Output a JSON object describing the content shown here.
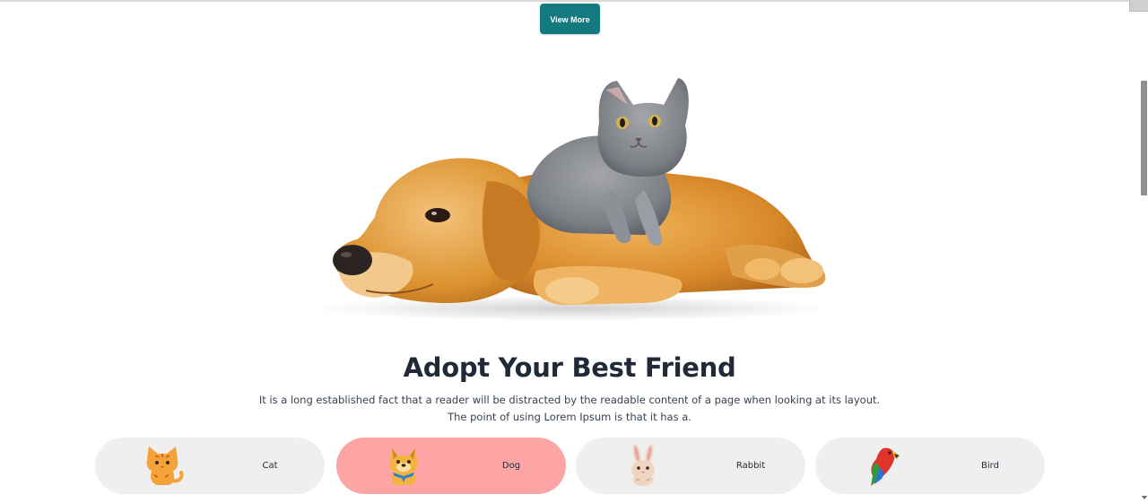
{
  "header": {
    "view_more_label": "View More"
  },
  "hero": {
    "title": "Adopt Your Best Friend",
    "description": "It is a long established fact that a reader will be distracted by the readable content of a page when looking at its layout. The point of using Lorem Ipsum is that it has a."
  },
  "pets": [
    {
      "label": "Cat",
      "icon": "cat-icon",
      "active": false
    },
    {
      "label": "Dog",
      "icon": "dog-icon",
      "active": true
    },
    {
      "label": "Rabbit",
      "icon": "rabbit-icon",
      "active": false
    },
    {
      "label": "Bird",
      "icon": "parrot-icon",
      "active": false
    }
  ],
  "colors": {
    "accent": "#137a7f",
    "active_card": "#fda4a4",
    "card": "#efefef",
    "heading": "#1f2937"
  }
}
